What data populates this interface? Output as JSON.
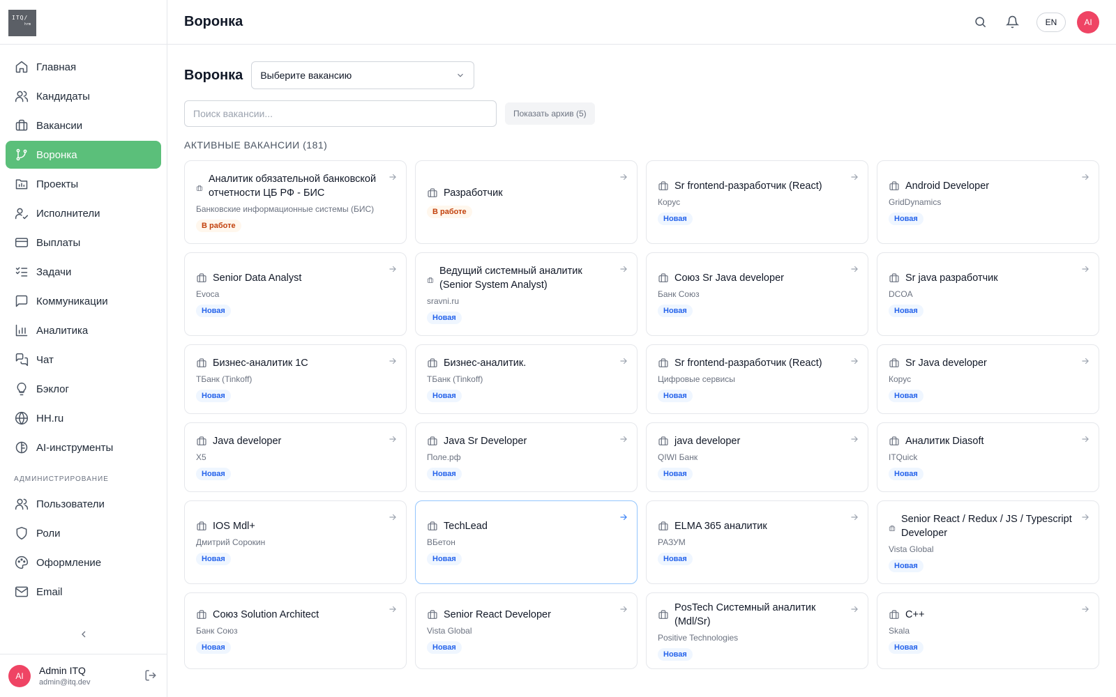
{
  "logo": {
    "line1": "ITQ/",
    "line2": "hrm"
  },
  "sidebar": {
    "items": [
      {
        "label": "Главная",
        "icon": "home-icon"
      },
      {
        "label": "Кандидаты",
        "icon": "users-icon"
      },
      {
        "label": "Вакансии",
        "icon": "briefcase-icon"
      },
      {
        "label": "Воронка",
        "icon": "git-branch-icon"
      },
      {
        "label": "Проекты",
        "icon": "folder-chart-icon"
      },
      {
        "label": "Исполнители",
        "icon": "user-check-icon"
      },
      {
        "label": "Выплаты",
        "icon": "credit-card-icon"
      },
      {
        "label": "Задачи",
        "icon": "list-checks-icon"
      },
      {
        "label": "Коммуникации",
        "icon": "message-square-icon"
      },
      {
        "label": "Аналитика",
        "icon": "bar-chart-icon"
      },
      {
        "label": "Чат",
        "icon": "chat-icon"
      },
      {
        "label": "Бэклог",
        "icon": "lightbulb-icon"
      },
      {
        "label": "HH.ru",
        "icon": "globe-icon"
      },
      {
        "label": "AI-инструменты",
        "icon": "brain-icon"
      }
    ],
    "admin_section": "АДМИНИСТРИРОВАНИЕ",
    "admin_items": [
      {
        "label": "Пользователи",
        "icon": "users-icon"
      },
      {
        "label": "Роли",
        "icon": "shield-icon"
      },
      {
        "label": "Оформление",
        "icon": "palette-icon"
      },
      {
        "label": "Email",
        "icon": "mail-icon"
      }
    ],
    "user": {
      "initials": "AI",
      "name": "Admin ITQ",
      "email": "admin@itq.dev"
    }
  },
  "header": {
    "title": "Воронка",
    "lang": "EN",
    "avatar": "AI"
  },
  "main": {
    "title": "Воронка",
    "select_value": "Выберите вакансию",
    "search_placeholder": "Поиск вакансии...",
    "archive_button": "Показать архив (5)",
    "count_label": "АКТИВНЫЕ ВАКАНСИИ (181)"
  },
  "accent_color": "#5bbf7a",
  "vacancies": [
    {
      "title": "Аналитик обязательной банковской отчетности ЦБ РФ - БИС",
      "company": "Банковские информационные системы (БИС)",
      "status": "В работе"
    },
    {
      "title": "Разработчик",
      "company": "",
      "status": "В работе"
    },
    {
      "title": "Sr frontend-разработчик (React)",
      "company": "Корус",
      "status": "Новая"
    },
    {
      "title": "Android Developer",
      "company": "GridDynamics",
      "status": "Новая"
    },
    {
      "title": "Senior Data Analyst",
      "company": "Evoca",
      "status": "Новая"
    },
    {
      "title": "Ведущий системный аналитик (Senior System Analyst)",
      "company": "sravni.ru",
      "status": "Новая"
    },
    {
      "title": "Союз Sr Java developer",
      "company": "Банк Союз",
      "status": "Новая"
    },
    {
      "title": "Sr java разработчик",
      "company": "DCOA",
      "status": "Новая"
    },
    {
      "title": "Бизнес-аналитик 1С",
      "company": "ТБанк (Tinkoff)",
      "status": "Новая"
    },
    {
      "title": "Бизнес-аналитик.",
      "company": "ТБанк (Tinkoff)",
      "status": "Новая"
    },
    {
      "title": "Sr frontend-разработчик (React)",
      "company": "Цифровые сервисы",
      "status": "Новая"
    },
    {
      "title": "Sr Java developer",
      "company": "Корус",
      "status": "Новая"
    },
    {
      "title": "Java developer",
      "company": "X5",
      "status": "Новая"
    },
    {
      "title": "Java Sr Developer",
      "company": "Поле.рф",
      "status": "Новая"
    },
    {
      "title": "java developer",
      "company": "QIWI Банк",
      "status": "Новая"
    },
    {
      "title": "Аналитик Diasoft",
      "company": "ITQuick",
      "status": "Новая"
    },
    {
      "title": "IOS Mdl+",
      "company": "Дмитрий Сорокин",
      "status": "Новая"
    },
    {
      "title": "TechLead",
      "company": "ВБетон",
      "status": "Новая"
    },
    {
      "title": "ELMA 365 аналитик",
      "company": "РАЗУМ",
      "status": "Новая"
    },
    {
      "title": "Senior React / Redux / JS / Typescript Developer",
      "company": "Vista Global",
      "status": "Новая"
    },
    {
      "title": "Союз Solution Architect",
      "company": "Банк Союз",
      "status": "Новая"
    },
    {
      "title": "Senior React Developer",
      "company": "Vista Global",
      "status": "Новая"
    },
    {
      "title": "PosTech Системный аналитик (Mdl/Sr)",
      "company": "Positive Technologies",
      "status": "Новая"
    },
    {
      "title": "C++",
      "company": "Skala",
      "status": "Новая"
    }
  ]
}
